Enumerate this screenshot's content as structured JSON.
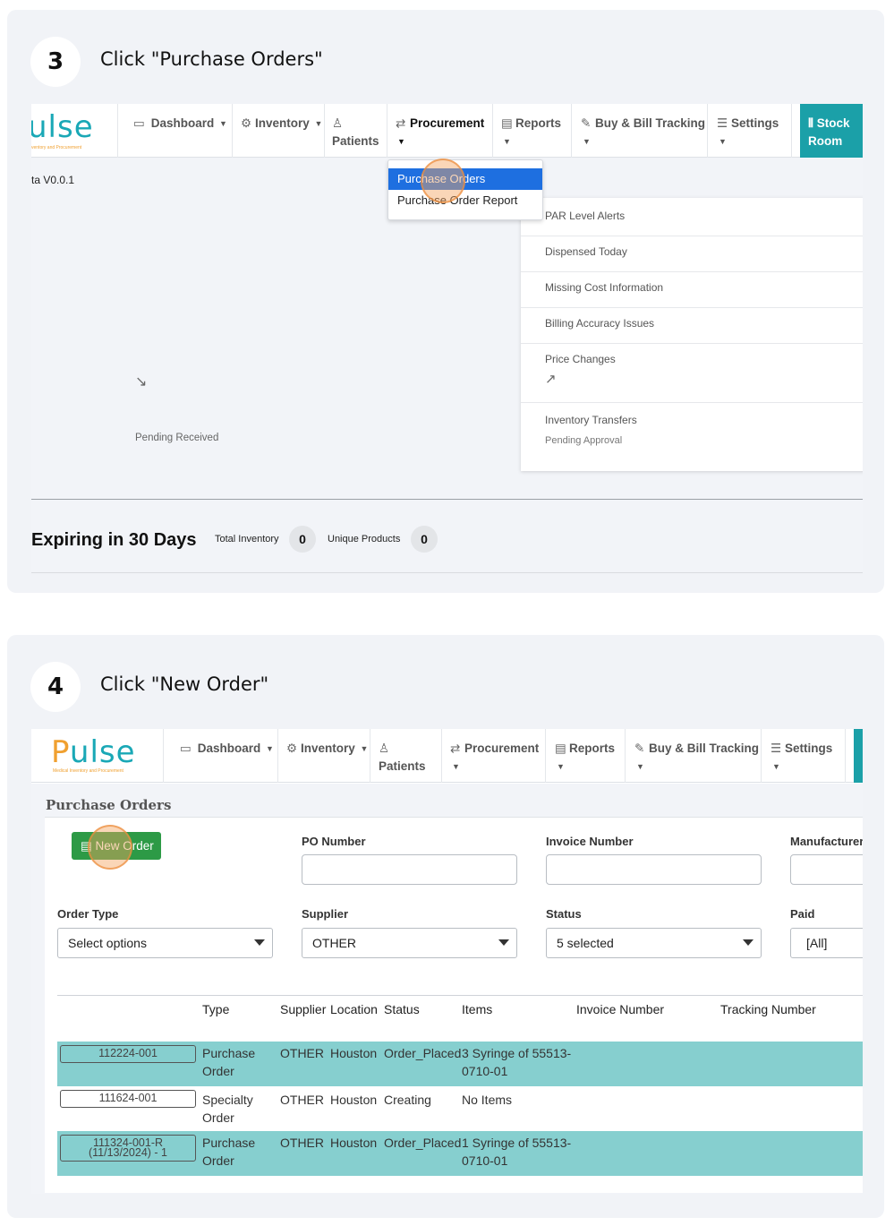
{
  "step3": {
    "number": "3",
    "title": "Click \"Purchase Orders\"",
    "logo_text": "ulse",
    "logo_sub": "ventory and Procurement",
    "version": "ta V0.0.1",
    "nav": {
      "dashboard": "Dashboard",
      "inventory": "Inventory",
      "patients": "Patients",
      "procurement": "Procurement",
      "reports": "Reports",
      "buy_bill": "Buy & Bill Tracking",
      "settings": "Settings",
      "stock_room_1": "Stock",
      "stock_room_2": "Room"
    },
    "dropdown": {
      "purchase_orders": "Purchase Orders",
      "purchase_order_report": "Purchase Order Report"
    },
    "alerts": {
      "par": "PAR Level Alerts",
      "dispensed": "Dispensed Today",
      "missing_cost": "Missing Cost Information",
      "billing": "Billing Accuracy Issues",
      "price": "Price Changes",
      "transfers": "Inventory Transfers",
      "pending_approval": "Pending Approval"
    },
    "pending_received": "Pending Received",
    "expiring_title": "Expiring in 30 Days",
    "total_inventory_label": "Total Inventory",
    "total_inventory_value": "0",
    "unique_products_label": "Unique Products",
    "unique_products_value": "0"
  },
  "step4": {
    "number": "4",
    "title": "Click \"New Order\"",
    "logo_p": "P",
    "logo_rest": "ulse",
    "logo_sub": "Medical Inventory and Procurement",
    "nav": {
      "dashboard": "Dashboard",
      "inventory": "Inventory",
      "patients": "Patients",
      "procurement": "Procurement",
      "reports": "Reports",
      "buy_bill": "Buy & Bill Tracking",
      "settings": "Settings"
    },
    "page_title": "Purchase Orders",
    "new_order": "New Order",
    "filters": {
      "po_number": "PO Number",
      "invoice_number": "Invoice Number",
      "manufacturer": "Manufacturer (",
      "order_type": "Order Type",
      "order_type_value": "Select options",
      "supplier": "Supplier",
      "supplier_value": "OTHER",
      "status": "Status",
      "status_value": "5 selected",
      "paid": "Paid",
      "paid_value": "[All]"
    },
    "columns": [
      "Type",
      "Supplier",
      "Location",
      "Status",
      "Items",
      "Invoice Number",
      "Tracking Number"
    ],
    "rows": [
      {
        "po": "112224-001",
        "type1": "Purchase",
        "type2": "Order",
        "supplier": "OTHER",
        "location": "Houston",
        "status": "Order_Placed",
        "items1": "3 Syringe of 55513-",
        "items2": "0710-01"
      },
      {
        "po": "111624-001",
        "type1": "Specialty",
        "type2": "Order",
        "supplier": "OTHER",
        "location": "Houston",
        "status": "Creating",
        "items1": "No Items",
        "items2": ""
      },
      {
        "po1": "111324-001-R",
        "po2": "(11/13/2024) - 1",
        "type1": "Purchase",
        "type2": "Order",
        "supplier": "OTHER",
        "location": "Houston",
        "status": "Order_Placed",
        "items1": "1 Syringe of 55513-",
        "items2": "0710-01"
      }
    ]
  },
  "colors": {
    "teal": "#1ba0a8",
    "row_teal": "#86cfcf",
    "green_button": "#2d9a46",
    "dropdown_selected": "#1e6fe0",
    "click_highlight": "#f4a460"
  }
}
